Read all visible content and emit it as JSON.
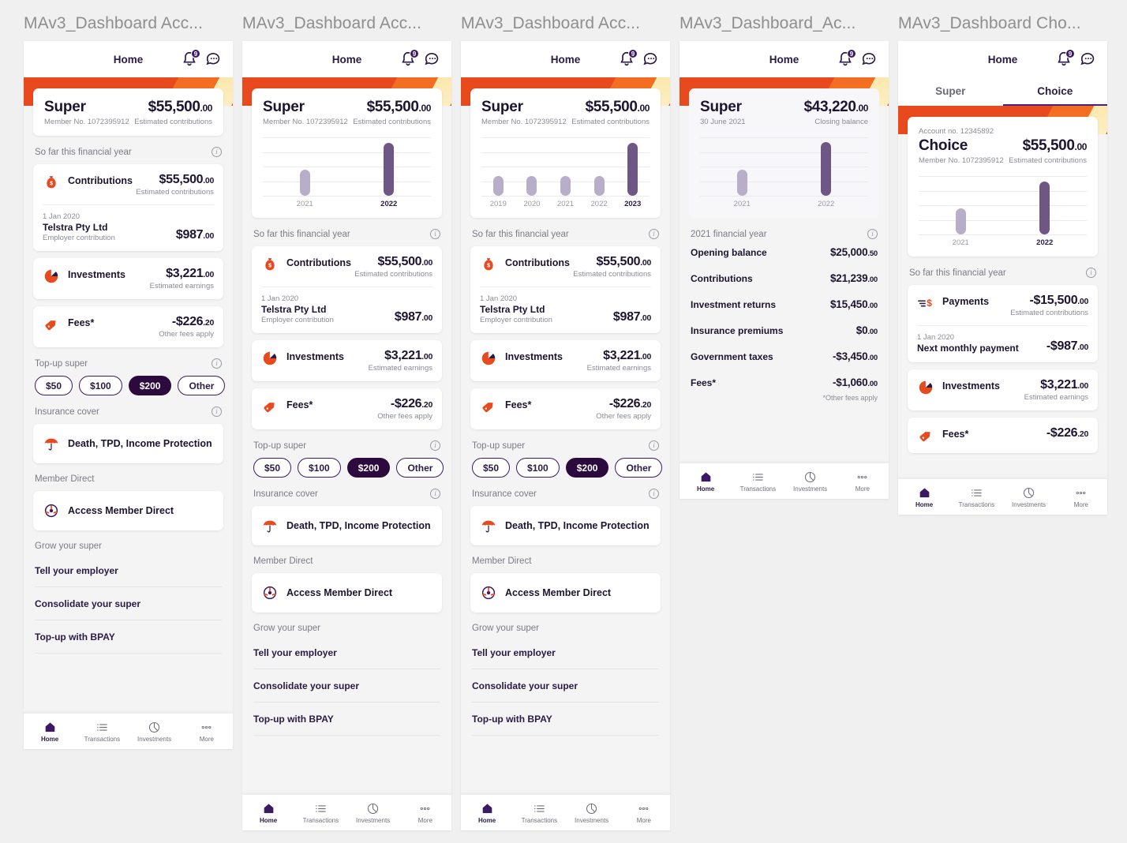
{
  "common": {
    "home_title": "Home",
    "bell_badge": "9",
    "bell_icon": "bell-icon",
    "chat_icon": "chat-icon",
    "nav": [
      {
        "label": "Home",
        "icon": "home-icon"
      },
      {
        "label": "Transactions",
        "icon": "list-icon"
      },
      {
        "label": "Investments",
        "icon": "pie-chart-icon"
      },
      {
        "label": "More",
        "icon": "ellipsis-icon"
      }
    ],
    "sec_so_far": "So far this financial year",
    "sec_topup": "Top-up super",
    "sec_insurance": "Insurance cover",
    "sec_member_direct": "Member Direct",
    "sec_grow": "Grow your super",
    "info_glyph": "i",
    "pills": [
      {
        "label": "$50",
        "selected": false
      },
      {
        "label": "$100",
        "selected": false
      },
      {
        "label": "$200",
        "selected": true
      },
      {
        "label": "Other",
        "selected": false
      }
    ],
    "insurance_row": {
      "label": "Death, TPD, Income Protection",
      "icon": "umbrella-icon"
    },
    "member_direct_row": {
      "label": "Access Member Direct",
      "icon": "steering-wheel-icon"
    },
    "grow_links": [
      "Tell your employer",
      "Consolidate your super",
      "Top-up with BPAY"
    ],
    "contributions": {
      "icon": "money-bag-icon",
      "label": "Contributions",
      "amount": "$55,500",
      "cents": ".00",
      "note": "Estimated contributions",
      "sub": {
        "date": "1 Jan 2020",
        "name": "Telstra Pty Ltd",
        "desc": "Employer contribution",
        "amount": "$987",
        "cents": ".00"
      }
    },
    "investments": {
      "icon": "pie-chart-icon",
      "label": "Investments",
      "amount": "$3,221",
      "cents": ".00",
      "note": "Estimated earnings"
    },
    "fees": {
      "icon": "tag-icon",
      "label": "Fees*",
      "amount": "-$226",
      "cents": ".20",
      "note": "Other fees apply"
    },
    "colors": {
      "banner_orange": "#e8491d",
      "banner_mid": "#f58220",
      "banner_light": "#fbe6a8",
      "bar": "#b9aec9",
      "bar_highlight": "#6e5685",
      "pill_selected": "#2d0a3e",
      "purple": "#3b1a63"
    }
  },
  "frames": [
    {
      "title": "MAv3_Dashboard Acc...",
      "hero": {
        "name": "Super",
        "member": "Member No. 1072395912",
        "amount": "$55,500",
        "cents": ".00",
        "sub": "Estimated contributions"
      },
      "has_chart": false
    },
    {
      "title": "MAv3_Dashboard Acc...",
      "hero": {
        "name": "Super",
        "member": "Member No. 1072395912",
        "amount": "$55,500",
        "cents": ".00",
        "sub": "Estimated contributions"
      },
      "has_chart": true,
      "chart_data": {
        "type": "bar",
        "title": "Super estimated contributions by year",
        "categories": [
          "2021",
          "2022"
        ],
        "values": [
          28000,
          55500
        ],
        "highlight_index": 1,
        "ylim": [
          0,
          62000
        ],
        "grid": true,
        "xlabel": "",
        "ylabel": ""
      }
    },
    {
      "title": "MAv3_Dashboard Acc...",
      "hero": {
        "name": "Super",
        "member": "Member No. 1072395912",
        "amount": "$55,500",
        "cents": ".00",
        "sub": "Estimated contributions"
      },
      "has_chart": true,
      "chart_data": {
        "type": "bar",
        "title": "Super estimated contributions by year",
        "categories": [
          "2019",
          "2020",
          "2021",
          "2022",
          "2023"
        ],
        "values": [
          21000,
          21000,
          21000,
          21000,
          55500
        ],
        "highlight_index": 4,
        "ylim": [
          0,
          62000
        ],
        "grid": true,
        "xlabel": "",
        "ylabel": ""
      }
    },
    {
      "title": "MAv3_Dashboard_Ac...",
      "hero": {
        "name": "Super",
        "member": "30 June 2021",
        "amount": "$43,220",
        "cents": ".00",
        "sub": "Closing balance"
      },
      "has_chart": true,
      "chart_data": {
        "type": "bar",
        "title": "Super closing balance by year",
        "categories": [
          "2021",
          "2022"
        ],
        "values": [
          21000,
          43220
        ],
        "highlight_index": 1,
        "ylim": [
          0,
          48000
        ],
        "grid": true,
        "xlabel": "",
        "ylabel": ""
      },
      "fy": {
        "section": "2021 financial year",
        "rows": [
          {
            "label": "Opening balance",
            "amount": "$25,000",
            "cents": ".50"
          },
          {
            "label": "Contributions",
            "amount": "$21,239",
            "cents": ".00"
          },
          {
            "label": "Investment returns",
            "amount": "$15,450",
            "cents": ".00"
          },
          {
            "label": "Insurance premiums",
            "amount": "$0",
            "cents": ".00"
          },
          {
            "label": "Government taxes",
            "amount": "-$3,450",
            "cents": ".00"
          },
          {
            "label": "Fees*",
            "amount": "-$1,060",
            "cents": ".00"
          }
        ],
        "footnote": "*Other fees apply"
      }
    },
    {
      "title": "MAv3_Dashboard Cho...",
      "tabs": [
        {
          "label": "Super",
          "active": false
        },
        {
          "label": "Choice",
          "active": true
        }
      ],
      "hero": {
        "account_no": "Account no. 12345892",
        "name": "Choice",
        "member": "Member No. 1072395912",
        "amount": "$55,500",
        "cents": ".00",
        "sub": "Estimated contributions"
      },
      "has_chart": true,
      "chart_data": {
        "type": "bar",
        "title": "Choice estimated contributions by year",
        "categories": [
          "2021",
          "2022"
        ],
        "values": [
          28000,
          55500
        ],
        "highlight_index": 1,
        "ylim": [
          0,
          62000
        ],
        "grid": true,
        "xlabel": "",
        "ylabel": ""
      },
      "payments": {
        "icon": "payments-icon",
        "label": "Payments",
        "amount": "-$15,500",
        "cents": ".00",
        "note": "Estimated contributions",
        "sub": {
          "date": "1 Jan 2020",
          "name": "Next monthly payment",
          "amount": "-$987",
          "cents": ".00"
        }
      },
      "partial_fees": {
        "icon": "tag-icon",
        "label": "Fees*",
        "amount": "-$226",
        "cents": ".20"
      }
    }
  ]
}
